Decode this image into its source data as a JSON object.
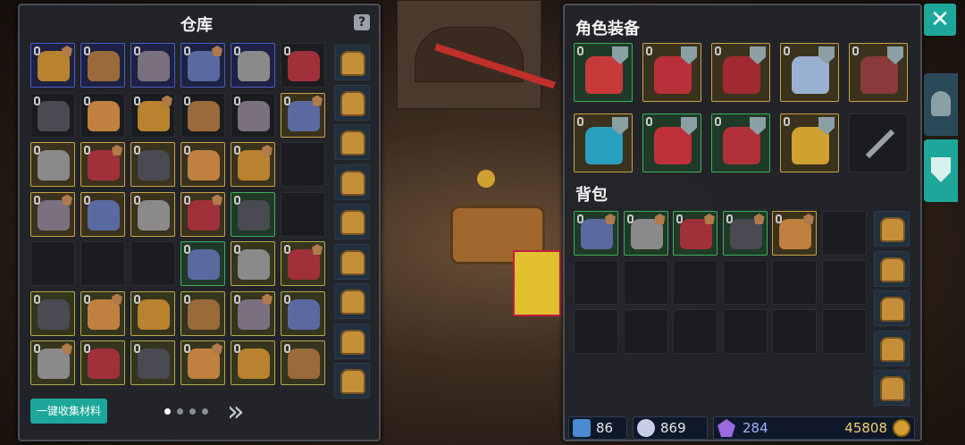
{
  "warehouse": {
    "title": "仓库",
    "help_icon": "question-icon",
    "collect_button": "一键收集材料",
    "pages": 4,
    "current_page": 1,
    "next_icon": "double-chevron-right-icon"
  },
  "equipment": {
    "title": "角色装备",
    "close_icon": "close-icon"
  },
  "backpack": {
    "title": "背包"
  },
  "currency": {
    "item1": "86",
    "item2": "869",
    "crystal": "284",
    "gold": "45808"
  },
  "side_tabs": [
    "helmet-tab-icon",
    "armor-tab-icon"
  ],
  "colors": {
    "blue": "#4a5cc0",
    "gold": "#c8a24a",
    "green": "#3fae5a",
    "olive": "#b3a94a",
    "teal_button": "#1ca79a"
  }
}
